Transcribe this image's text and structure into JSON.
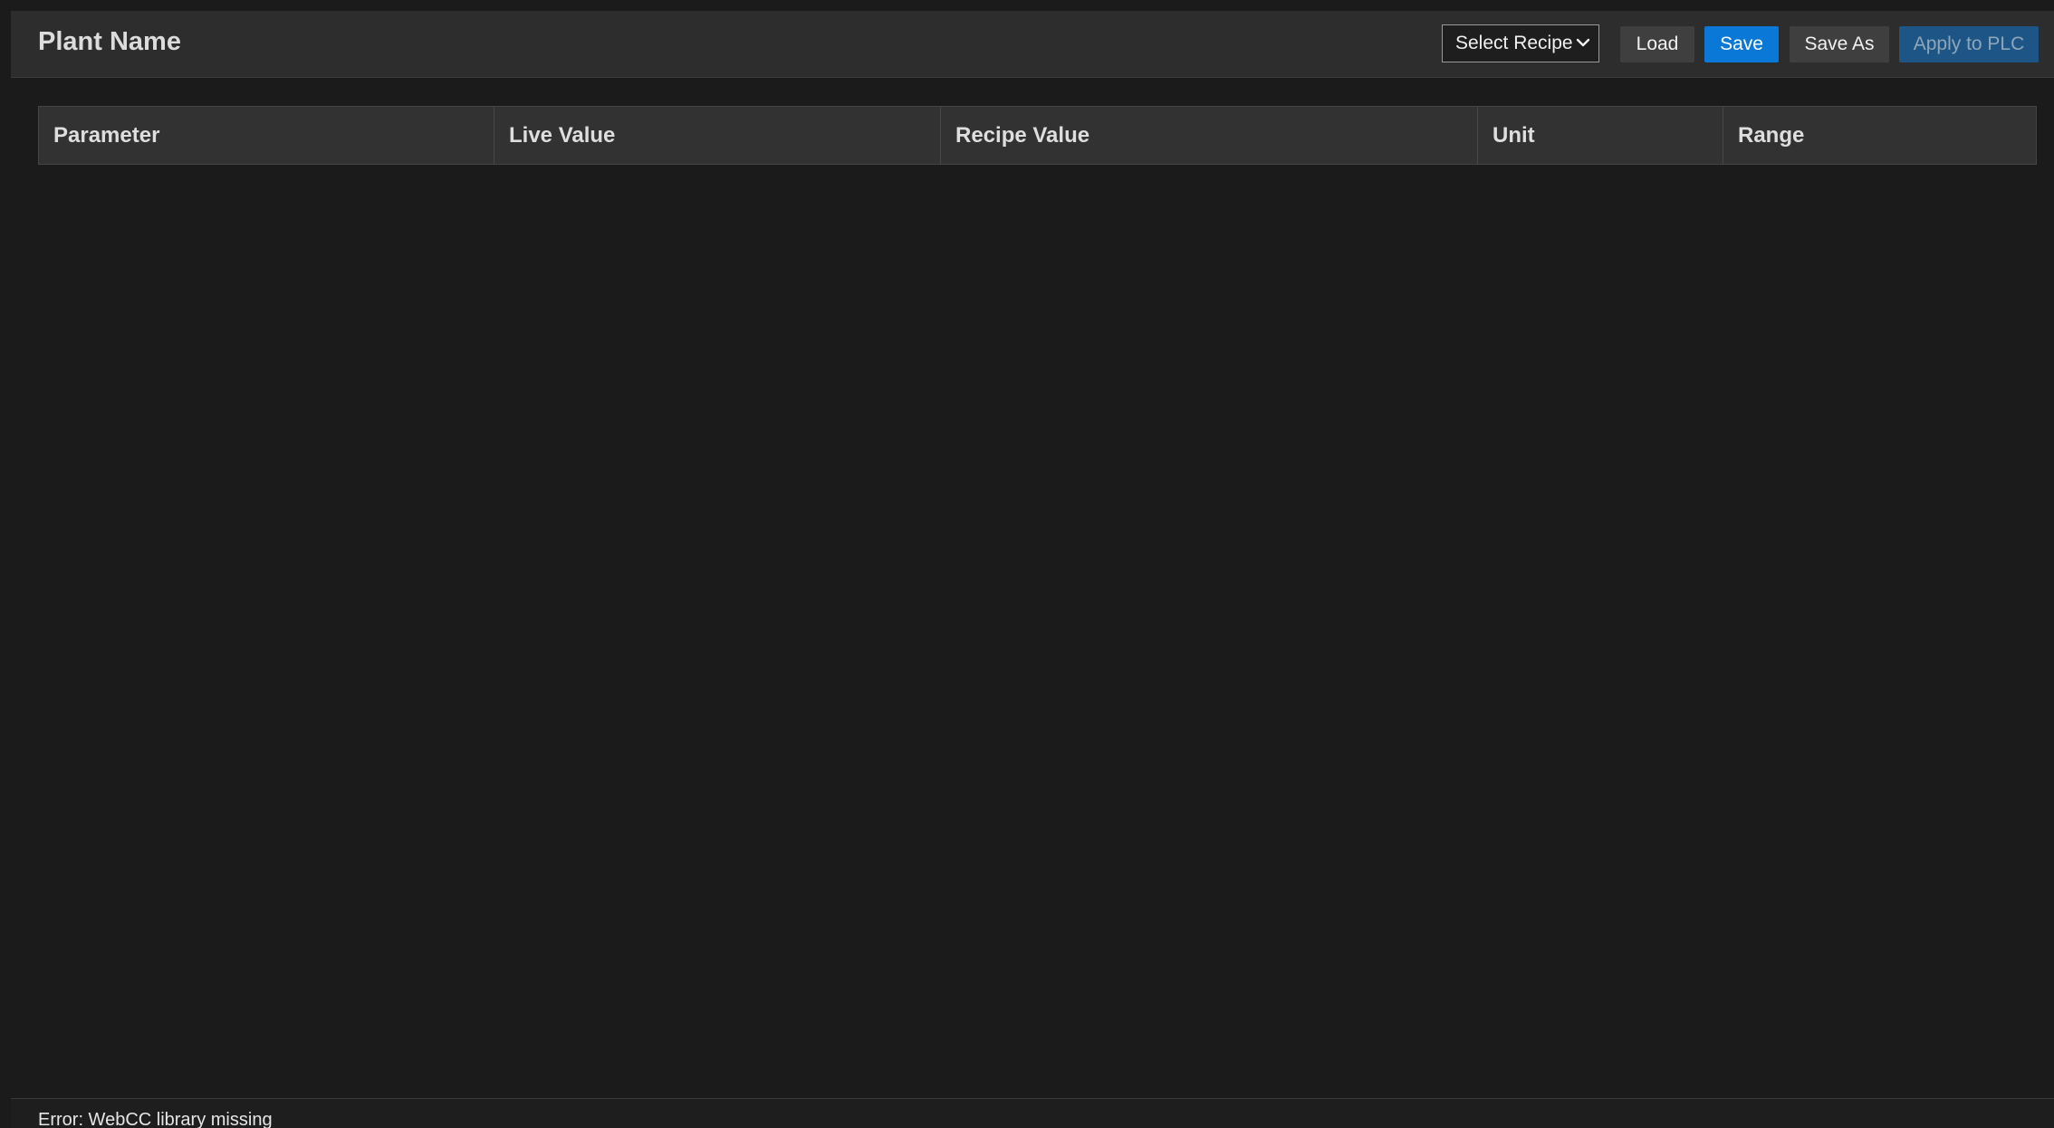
{
  "header": {
    "plant_name": "Plant Name",
    "recipe_select": {
      "selected": "Select Recipe",
      "icon": "chevron-down-icon"
    },
    "buttons": {
      "load": "Load",
      "save": "Save",
      "save_as": "Save As",
      "apply": "Apply to PLC"
    }
  },
  "table": {
    "columns": [
      "Parameter",
      "Live Value",
      "Recipe Value",
      "Unit",
      "Range"
    ],
    "rows": []
  },
  "status": {
    "message": "Error: WebCC library missing"
  },
  "colors": {
    "background": "#1b1b1b",
    "header_bg": "#2d2d2d",
    "primary_button": "#0a78d7",
    "secondary_button": "#3f3f3f",
    "disabled_button": "#1d5686"
  }
}
